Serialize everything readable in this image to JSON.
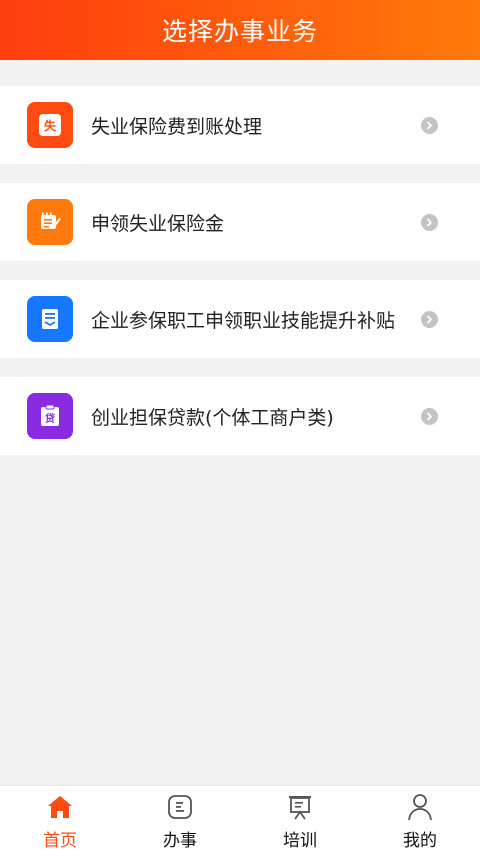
{
  "header": {
    "title": "选择办事业务"
  },
  "services": [
    {
      "label": "失业保险费到账处理",
      "icon": "unemployment-doc-icon",
      "icon_char": "失",
      "color": "#ff4a12"
    },
    {
      "label": "申领失业保险金",
      "icon": "pen-note-icon",
      "icon_char": "",
      "color": "#ff7a0d"
    },
    {
      "label": "企业参保职工申领职业技能提升补贴",
      "icon": "document-list-icon",
      "icon_char": "",
      "color": "#1677ff"
    },
    {
      "label": "创业担保贷款(个体工商户类)",
      "icon": "loan-clipboard-icon",
      "icon_char": "贷",
      "color": "#8a2be2"
    }
  ],
  "tabbar": {
    "active_color": "#ff4a12",
    "items": [
      {
        "label": "首页",
        "icon": "home-icon",
        "active": true
      },
      {
        "label": "办事",
        "icon": "task-list-icon",
        "active": false
      },
      {
        "label": "培训",
        "icon": "presentation-board-icon",
        "active": false
      },
      {
        "label": "我的",
        "icon": "user-icon",
        "active": false
      }
    ]
  }
}
